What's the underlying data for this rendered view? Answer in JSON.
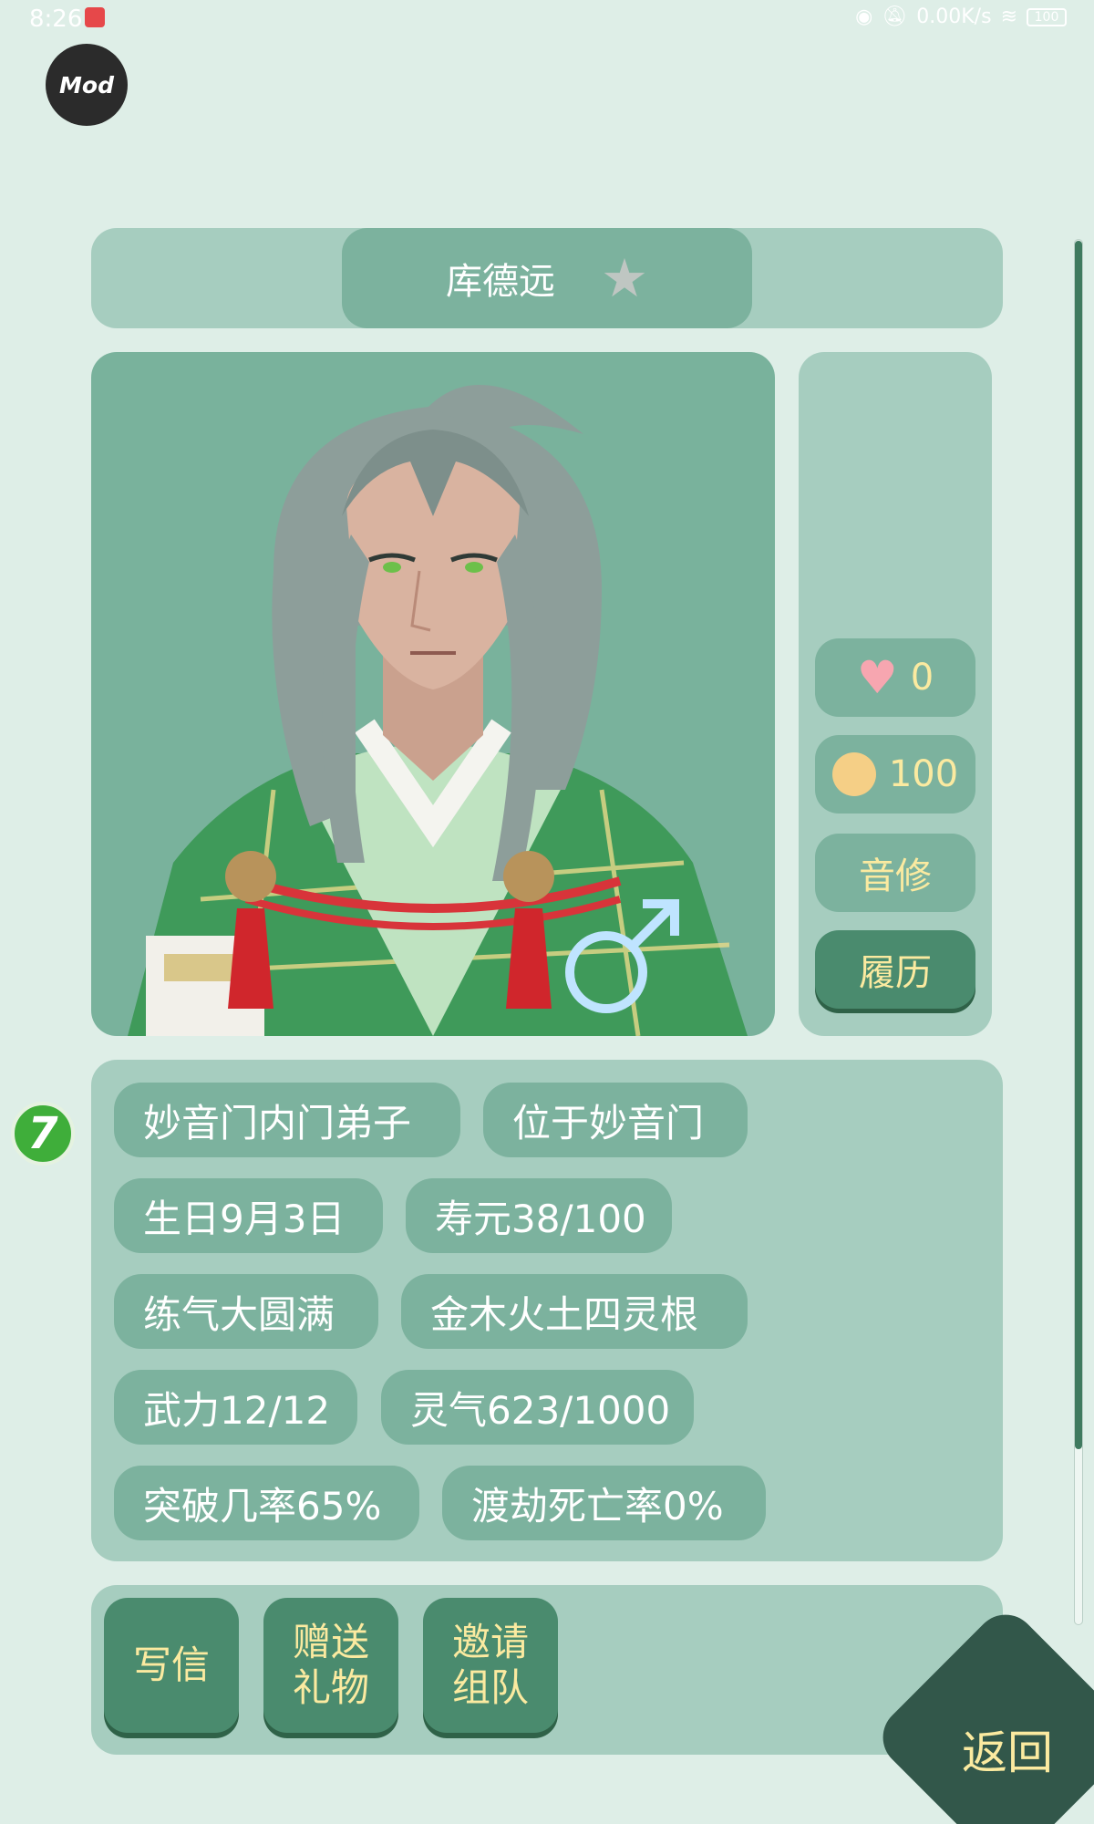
{
  "status_bar": {
    "time": "8:26",
    "network_speed": "0.00K/s",
    "battery": "100"
  },
  "mod_badge": "Mod",
  "character": {
    "name": "库德远",
    "gender_symbol": "♂",
    "favorite_icon": "star-icon"
  },
  "stats": {
    "affection": "0",
    "mood": "100",
    "cultivation_path": "音修",
    "resume_label": "履历"
  },
  "info_tags": [
    "妙音门内门弟子",
    "位于妙音门",
    "生日9月3日",
    "寿元38/100",
    "练气大圆满",
    "金木火土四灵根",
    "武力12/12",
    "灵气623/1000",
    "突破几率65%",
    "渡劫死亡率0%"
  ],
  "level_badge": "7",
  "actions": [
    "写信",
    "赠送\n礼物",
    "邀请\n组队"
  ],
  "back_label": "返回",
  "colors": {
    "background": "#deeee7",
    "panel": "#a6cdbf",
    "chip": "#7cb29e",
    "button_dark": "#4a8b6e",
    "accent_text": "#fbeaa0"
  }
}
